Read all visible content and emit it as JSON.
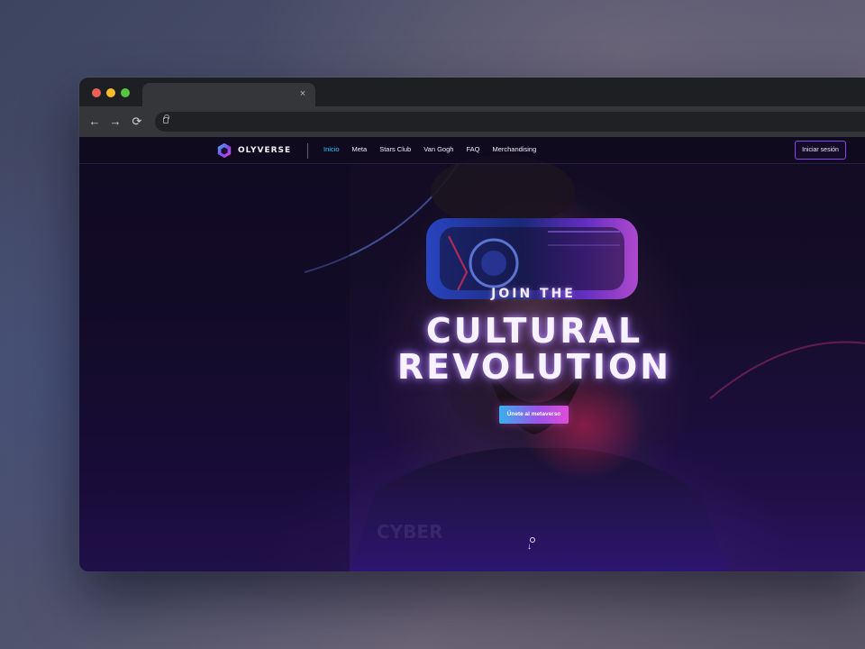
{
  "browser": {
    "tab_close": "×",
    "back": "←",
    "forward": "→",
    "reload": "⟳"
  },
  "site": {
    "logo_text": "OLYVERSE",
    "nav": [
      {
        "label": "Inicio",
        "active": true
      },
      {
        "label": "Meta"
      },
      {
        "label": "Stars Club"
      },
      {
        "label": "Van Gogh"
      },
      {
        "label": "FAQ"
      },
      {
        "label": "Merchandising"
      }
    ],
    "login_label": "Iniciar sesión"
  },
  "hero": {
    "kicker": "JOIN THE",
    "title_line1": "CULTURAL",
    "title_line2": "REVOLUTION",
    "cta_label": "Únete al metaverso",
    "shirt_text": "CYBER"
  },
  "colors": {
    "accent_cyan": "#39c8f2",
    "accent_purple": "#8a46f0",
    "accent_magenta": "#e04ad8"
  }
}
